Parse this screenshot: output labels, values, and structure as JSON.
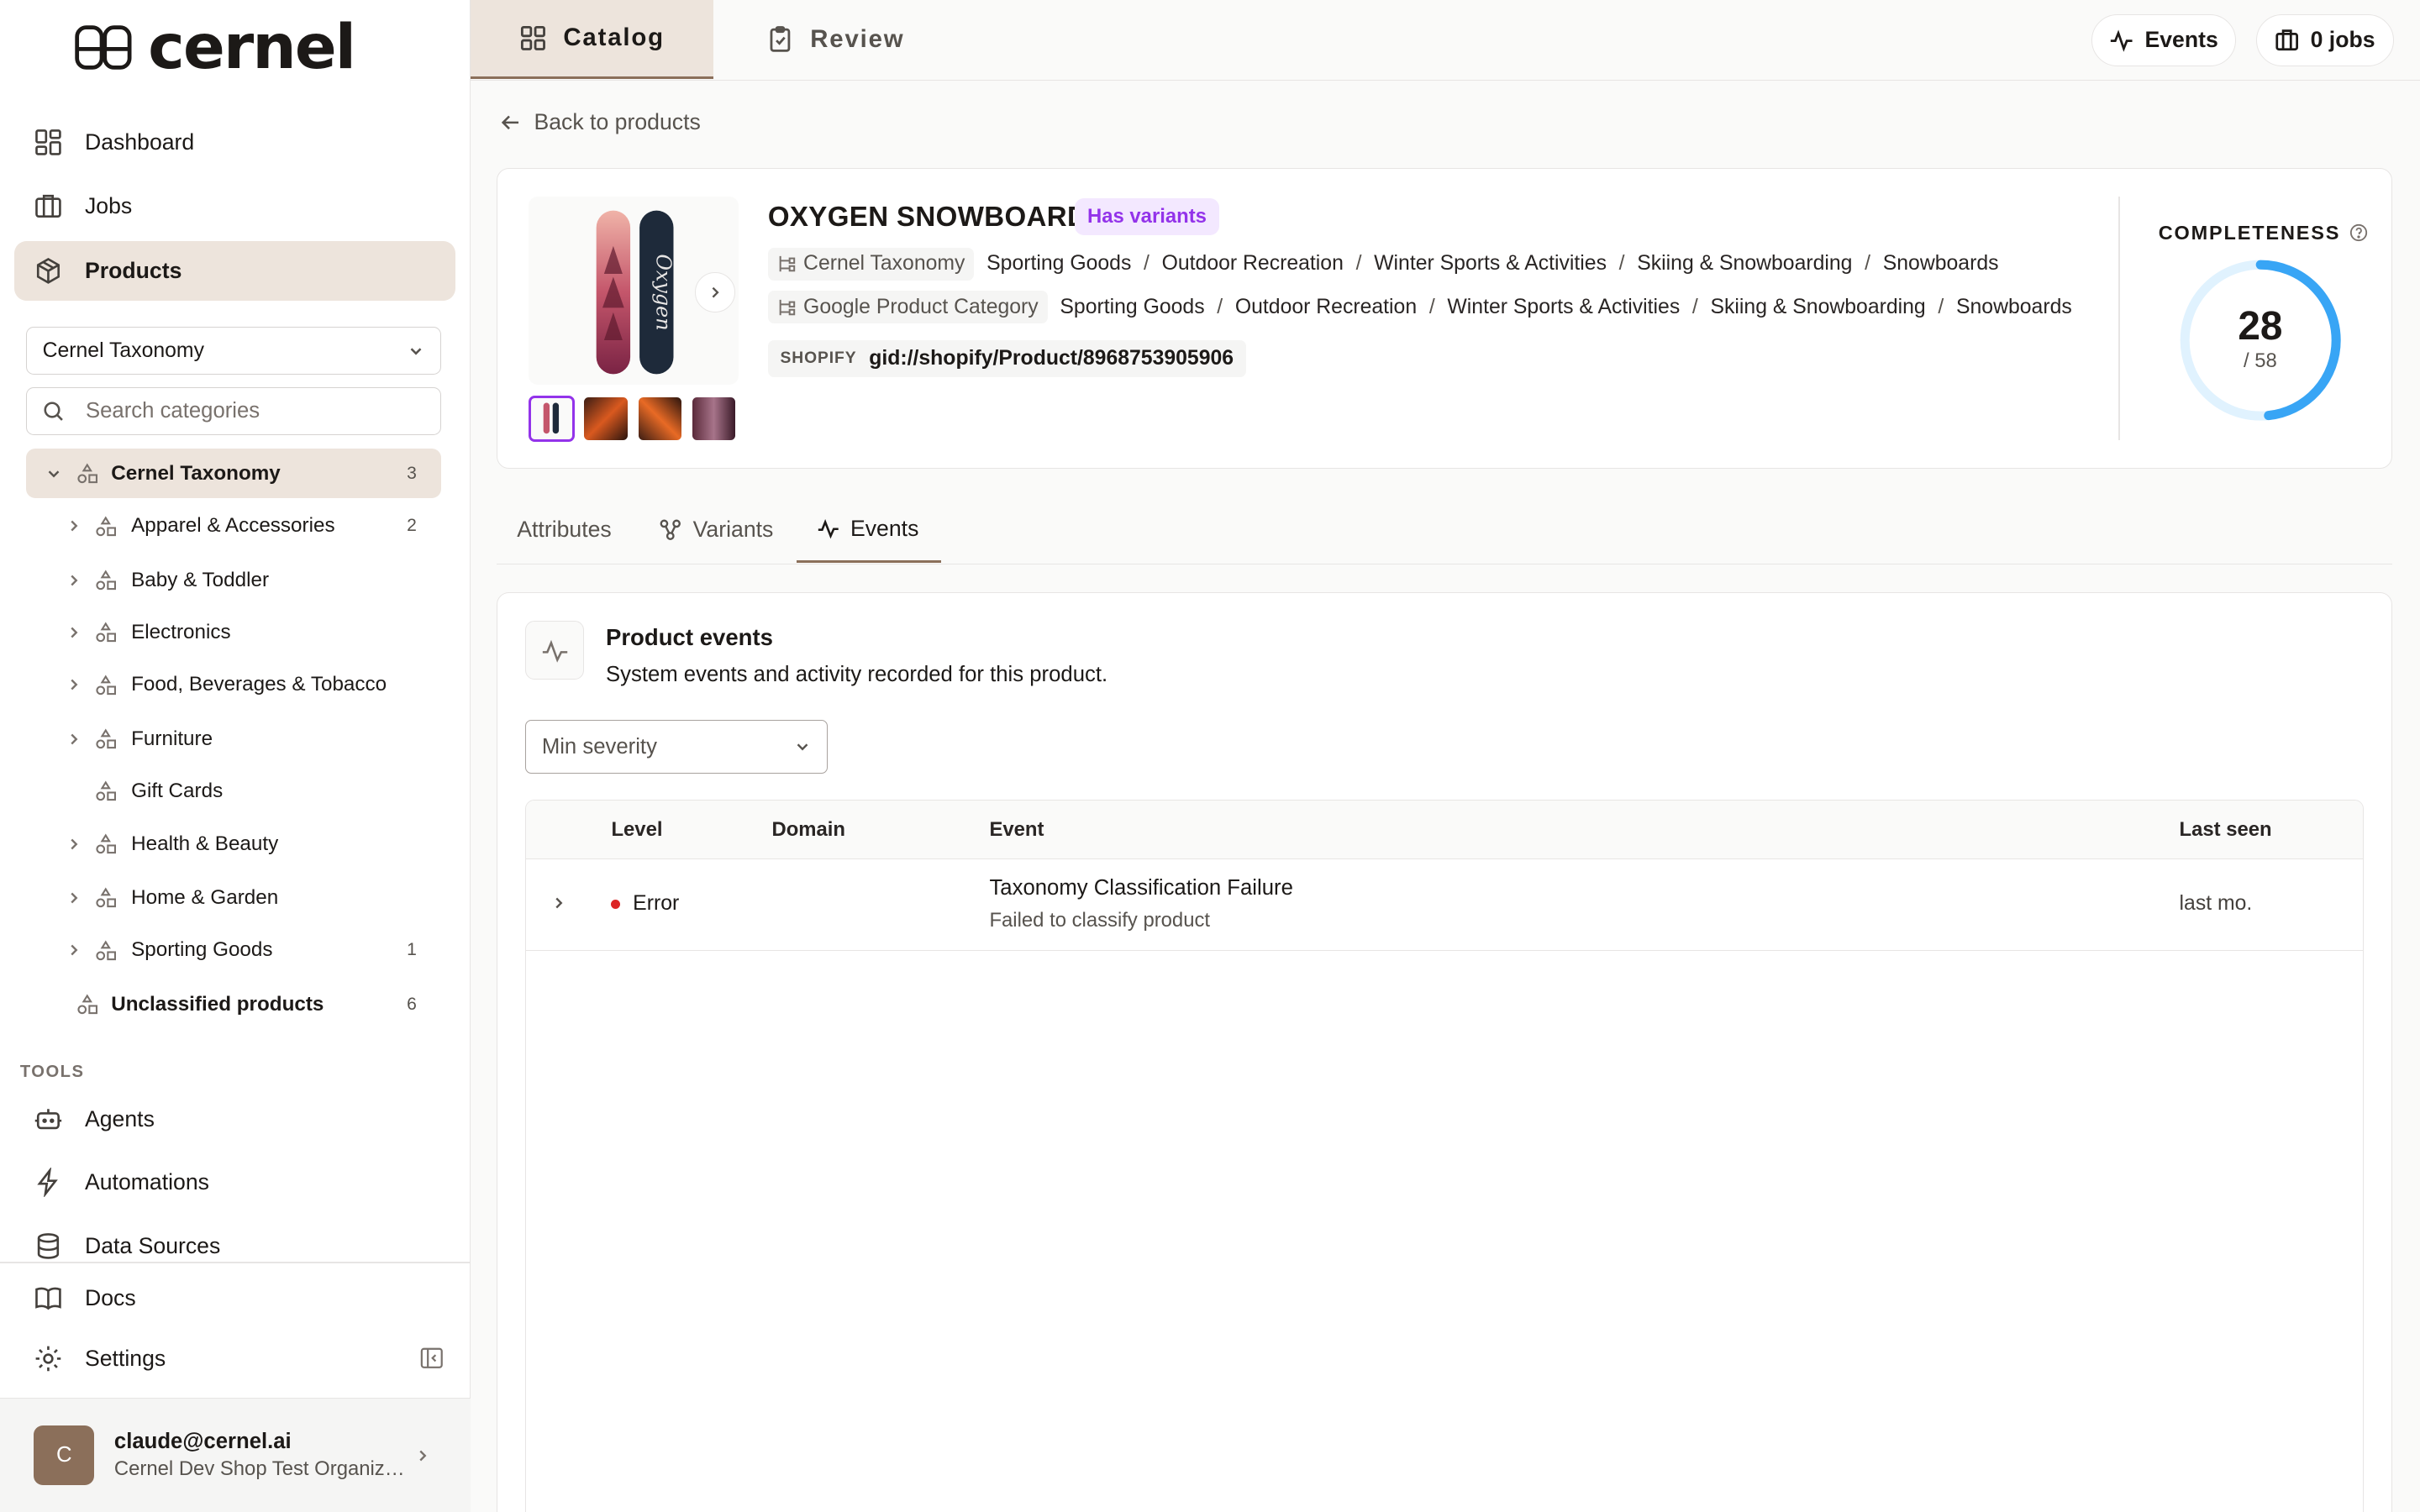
{
  "app": {
    "name": "cernel"
  },
  "sidebar": {
    "nav": [
      {
        "label": "Dashboard"
      },
      {
        "label": "Jobs"
      },
      {
        "label": "Products"
      }
    ],
    "taxonomy_select": "Cernel Taxonomy",
    "search_placeholder": "Search categories",
    "tree": {
      "root": {
        "label": "Cernel Taxonomy",
        "count": "3"
      },
      "children": [
        {
          "label": "Apparel & Accessories",
          "count": "2"
        },
        {
          "label": "Baby & Toddler",
          "count": ""
        },
        {
          "label": "Electronics",
          "count": ""
        },
        {
          "label": "Food, Beverages & Tobacco",
          "count": ""
        },
        {
          "label": "Furniture",
          "count": ""
        },
        {
          "label": "Gift Cards",
          "count": ""
        },
        {
          "label": "Health & Beauty",
          "count": ""
        },
        {
          "label": "Home & Garden",
          "count": ""
        },
        {
          "label": "Sporting Goods",
          "count": "1"
        }
      ],
      "unclassified": {
        "label": "Unclassified products",
        "count": "6"
      }
    },
    "tools_label": "TOOLS",
    "tools": [
      {
        "label": "Agents"
      },
      {
        "label": "Automations"
      },
      {
        "label": "Data Sources"
      }
    ],
    "bottom": [
      {
        "label": "Docs"
      },
      {
        "label": "Settings"
      }
    ],
    "user": {
      "initial": "C",
      "email": "claude@cernel.ai",
      "org": "Cernel Dev Shop Test Organization"
    }
  },
  "topbar": {
    "tabs": [
      {
        "label": "Catalog"
      },
      {
        "label": "Review"
      }
    ],
    "events_label": "Events",
    "jobs_label": "0 jobs"
  },
  "back_label": "Back to products",
  "product": {
    "title": "OXYGEN SNOWBOARD",
    "badge": "Has variants",
    "cernel_taxonomy": {
      "tag": "Cernel Taxonomy",
      "path": [
        "Sporting Goods",
        "Outdoor Recreation",
        "Winter Sports & Activities",
        "Skiing & Snowboarding",
        "Snowboards"
      ]
    },
    "google_category": {
      "tag": "Google Product Category",
      "path": [
        "Sporting Goods",
        "Outdoor Recreation",
        "Winter Sports & Activities",
        "Skiing & Snowboarding",
        "Snowboards"
      ]
    },
    "shopify": {
      "tag": "SHOPIFY",
      "id": "gid://shopify/Product/8968753905906"
    },
    "completeness": {
      "label": "COMPLETENESS",
      "value": 28,
      "total": 58,
      "total_label": "/ 58",
      "color": "#38a5f5"
    }
  },
  "product_tabs": [
    {
      "label": "Attributes"
    },
    {
      "label": "Variants"
    },
    {
      "label": "Events"
    }
  ],
  "events": {
    "title": "Product events",
    "subtitle": "System events and activity recorded for this product.",
    "severity_placeholder": "Min severity",
    "columns": {
      "level": "Level",
      "domain": "Domain",
      "event": "Event",
      "last_seen": "Last seen"
    },
    "rows": [
      {
        "level": "Error",
        "domain": "",
        "event": "Taxonomy Classification Failure",
        "detail": "Failed to classify product",
        "last_seen": "last mo."
      }
    ]
  }
}
